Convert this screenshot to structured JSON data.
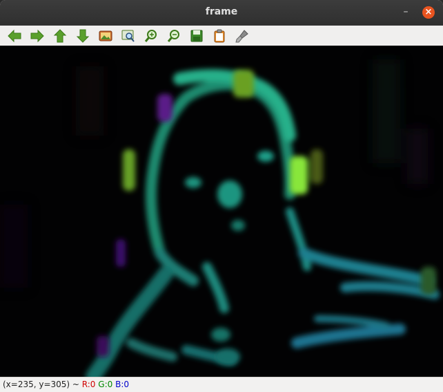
{
  "window": {
    "title": "frame"
  },
  "controls": {
    "minimize": "–",
    "close": "×"
  },
  "toolbar": {
    "icons": [
      "arrow-left-icon",
      "arrow-right-icon",
      "arrow-up-icon",
      "arrow-down-icon",
      "image-icon",
      "zoom-fit-icon",
      "zoom-in-icon",
      "zoom-out-icon",
      "save-icon",
      "clipboard-icon",
      "brush-icon"
    ]
  },
  "status": {
    "coords": "(x=235, y=305) ~ ",
    "r": "R:0",
    "g": "G:0",
    "b": "B:0"
  },
  "colors": {
    "accent": "#e95420",
    "icon_green": "#5aa02c",
    "frame_bg": "#000000"
  }
}
